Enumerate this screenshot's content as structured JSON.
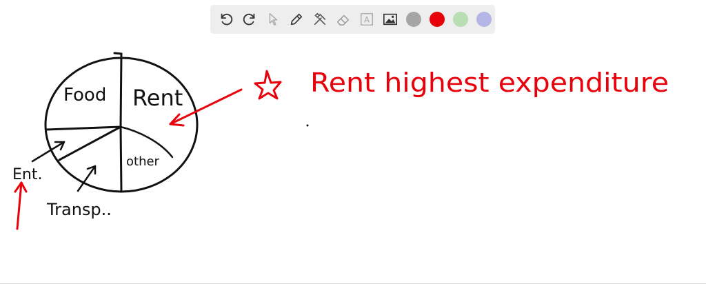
{
  "toolbar": {
    "tools": [
      {
        "name": "undo-icon"
      },
      {
        "name": "redo-icon"
      },
      {
        "name": "pointer-icon"
      },
      {
        "name": "pen-icon"
      },
      {
        "name": "tools-icon"
      },
      {
        "name": "eraser-icon"
      },
      {
        "name": "text-icon",
        "glyph": "A"
      },
      {
        "name": "image-icon"
      }
    ],
    "colors": [
      {
        "name": "gray",
        "hex": "#a6a6a6"
      },
      {
        "name": "red",
        "hex": "#e8000b"
      },
      {
        "name": "green",
        "hex": "#b9deb4"
      },
      {
        "name": "purple",
        "hex": "#b4b4e6"
      }
    ]
  },
  "drawing": {
    "ink_black": "#111111",
    "ink_red": "#e8000b",
    "labels": {
      "food": "Food",
      "rent": "Rent",
      "other": "other",
      "ent": "Ent.",
      "transp": "Transp.."
    },
    "note": "Rent highest expenditure"
  }
}
